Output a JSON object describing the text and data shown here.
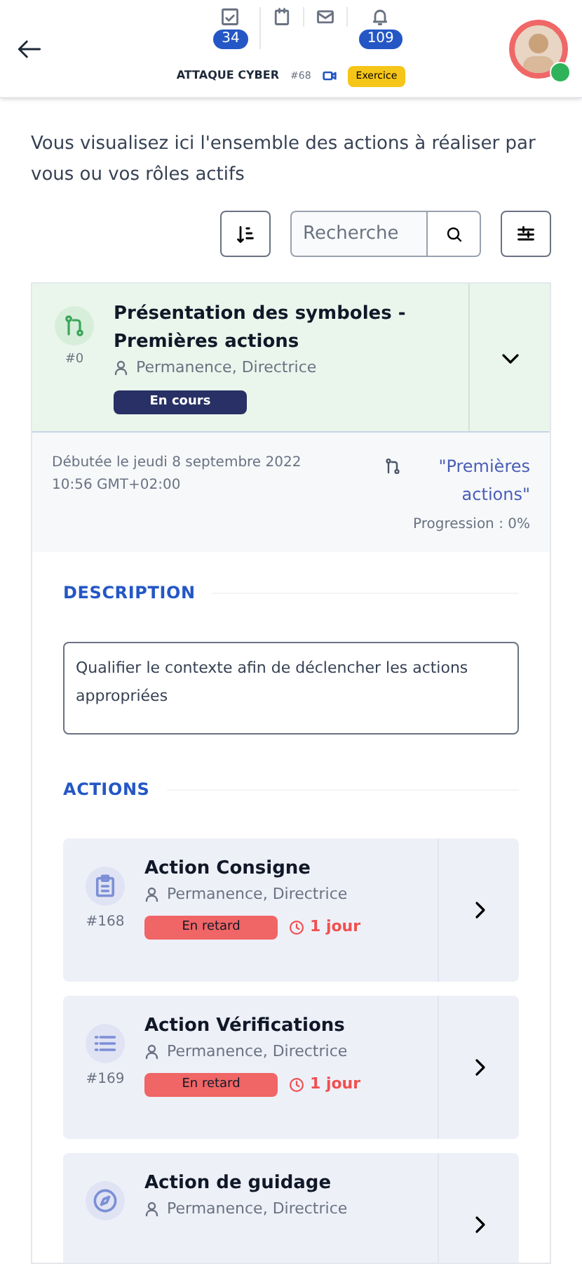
{
  "header": {
    "counters": [
      {
        "kind": "tasks",
        "badge": "34"
      },
      {
        "kind": "calendar"
      },
      {
        "kind": "mail"
      },
      {
        "kind": "bell",
        "badge": "109"
      }
    ],
    "title": "ATTAQUE CYBER",
    "code": "#68",
    "mode": "Exercice"
  },
  "intro": "Vous visualisez ici l'ensemble des actions à réaliser par vous ou vos rôles actifs",
  "search": {
    "placeholder": "Recherche"
  },
  "step": {
    "title": "Présentation des symboles - Premières actions",
    "number": "#0",
    "roles": "Permanence, Directrice",
    "status": "En cours",
    "expanded": true,
    "started": "Débutée le jeudi 8 septembre 2022 10:56 GMT+02:00",
    "link": "\"Premières actions\"",
    "progress": "Progression : 0%"
  },
  "description": {
    "heading": "DESCRIPTION",
    "text": "Qualifier le contexte afin de déclencher les actions appropriées"
  },
  "actions_heading": "ACTIONS",
  "actions": [
    {
      "kind": "clipboard",
      "title": "Action Consigne",
      "number": "#168",
      "roles": "Permanence, Directrice",
      "status": "En retard",
      "delay": "1 jour"
    },
    {
      "kind": "list",
      "title": "Action Vérifications",
      "number": "#169",
      "roles": "Permanence, Directrice",
      "status": "En retard",
      "delay": "1 jour"
    },
    {
      "kind": "compass",
      "title": "Action de guidage",
      "roles": "Permanence, Directrice"
    }
  ]
}
